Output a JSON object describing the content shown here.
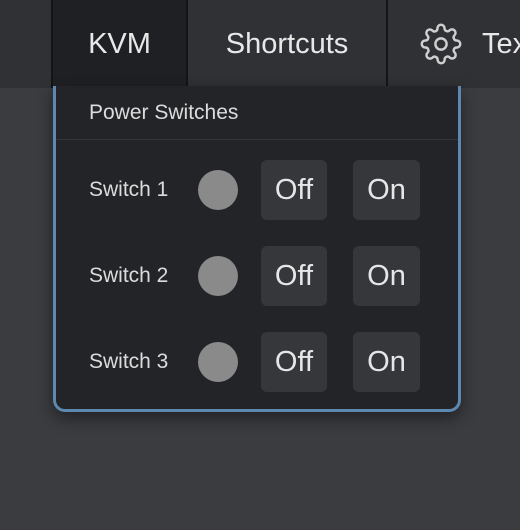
{
  "nav": {
    "items": [
      {
        "label": "KVM"
      },
      {
        "label": "Shortcuts"
      },
      {
        "label": "Text",
        "icon": "gear-icon"
      }
    ]
  },
  "panel": {
    "title": "Power Switches",
    "switches": [
      {
        "label": "Switch 1",
        "off_label": "Off",
        "on_label": "On",
        "status_color": "#8a8a8a"
      },
      {
        "label": "Switch 2",
        "off_label": "Off",
        "on_label": "On",
        "status_color": "#8a8a8a"
      },
      {
        "label": "Switch 3",
        "off_label": "Off",
        "on_label": "On",
        "status_color": "#8a8a8a"
      }
    ]
  },
  "colors": {
    "panel_border": "#5d88b0",
    "nav_active_bg": "#1f2023",
    "page_bg": "#3a3c40"
  }
}
